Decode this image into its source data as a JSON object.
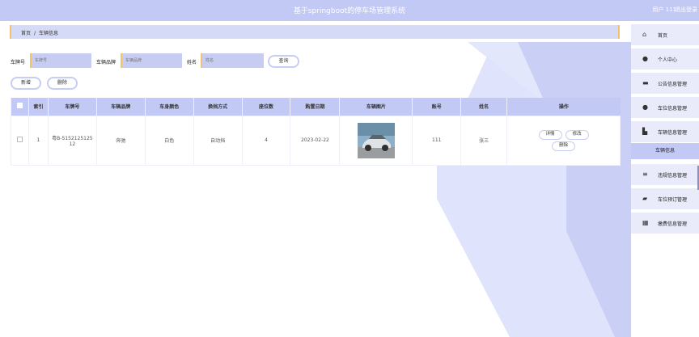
{
  "header": {
    "title": "基于springboot的停车场管理系统",
    "user": "用户 111",
    "logout": "退出登录"
  },
  "breadcrumb": {
    "home": "首页",
    "separator": "/",
    "current": "车辆信息"
  },
  "search": {
    "plate_label": "车牌号",
    "plate_placeholder": "车牌号",
    "brand_label": "车辆品牌",
    "brand_placeholder": "车辆品牌",
    "name_label": "姓名",
    "name_placeholder": "姓名",
    "query_button": "查询"
  },
  "actions": {
    "add": "新增",
    "delete": "删除"
  },
  "table": {
    "headers": [
      "索引",
      "车牌号",
      "车辆品牌",
      "车身颜色",
      "换挡方式",
      "座位数",
      "购置日期",
      "车辆图片",
      "账号",
      "姓名",
      "操作"
    ],
    "rows": [
      {
        "index": "1",
        "plate": "粤B-515212512512",
        "brand": "奔驰",
        "color": "白色",
        "gearbox": "自动挡",
        "seats": "4",
        "date": "2023-02-22",
        "account": "111",
        "name": "张三",
        "op_detail": "详情",
        "op_edit": "修改",
        "op_delete": "删除"
      }
    ]
  },
  "sidebar": {
    "items": [
      {
        "icon": "home-icon",
        "label": "首页"
      },
      {
        "icon": "user-icon",
        "label": "个人中心"
      },
      {
        "icon": "monitor-icon",
        "label": "公告信息管理"
      },
      {
        "icon": "user-icon",
        "label": "车位信息管理"
      },
      {
        "icon": "building-icon",
        "label": "车辆信息管理"
      },
      {
        "icon": "list-icon",
        "label": "违规信息管理"
      },
      {
        "icon": "chat-icon",
        "label": "车位预订管理"
      },
      {
        "icon": "grid-icon",
        "label": "缴费信息管理"
      }
    ],
    "submenu": {
      "label": "车辆信息"
    }
  },
  "colors": {
    "accent": "#c3c9f5",
    "highlight": "#f5c26b",
    "sidebar_bg": "#e9ebfb"
  }
}
